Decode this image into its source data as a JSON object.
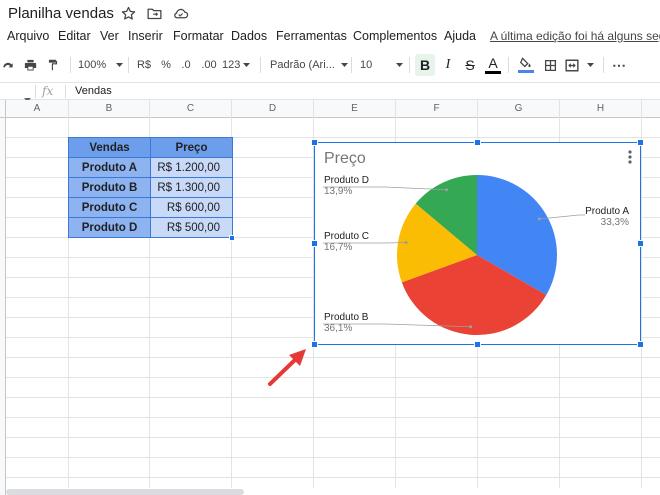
{
  "title": "Planilha vendas",
  "menu": [
    "Arquivo",
    "Editar",
    "Ver",
    "Inserir",
    "Formatar",
    "Dados",
    "Ferramentas",
    "Complementos",
    "Ajuda"
  ],
  "last_edit": "A última edição foi há alguns seg",
  "toolbar": {
    "zoom": "100%",
    "currency": "R$",
    "percent": "%",
    "decimal_less": ".0",
    "decimal_more": ".00",
    "more_formats": "123",
    "font": "Padrão (Ari...",
    "font_size": "10",
    "bold": "B",
    "italic": "I",
    "strike": "S",
    "text_color": "A",
    "more": "⋯"
  },
  "formula_bar": {
    "name_box": "",
    "fx": "fx",
    "value": "Vendas"
  },
  "columns": [
    "A",
    "B",
    "C",
    "D",
    "E",
    "F",
    "G",
    "H"
  ],
  "table": {
    "headers": [
      "Vendas",
      "Preço"
    ],
    "rows": [
      [
        "Produto A",
        "R$ 1.200,00"
      ],
      [
        "Produto B",
        "R$ 1.300,00"
      ],
      [
        "Produto C",
        "R$ 600,00"
      ],
      [
        "Produto D",
        "R$ 500,00"
      ]
    ]
  },
  "colors": {
    "produto_a": "#4285f4",
    "produto_b": "#ea4335",
    "produto_c": "#fbbc04",
    "produto_d": "#34a853",
    "arrow": "#e53935",
    "selection": "#1a73e8"
  },
  "chart_data": {
    "type": "pie",
    "title": "Preço",
    "categories": [
      "Produto A",
      "Produto B",
      "Produto C",
      "Produto D"
    ],
    "values": [
      1200,
      1300,
      600,
      500
    ],
    "percent_labels": [
      "33,3%",
      "36,1%",
      "16,7%",
      "13,9%"
    ],
    "legend": "none"
  }
}
